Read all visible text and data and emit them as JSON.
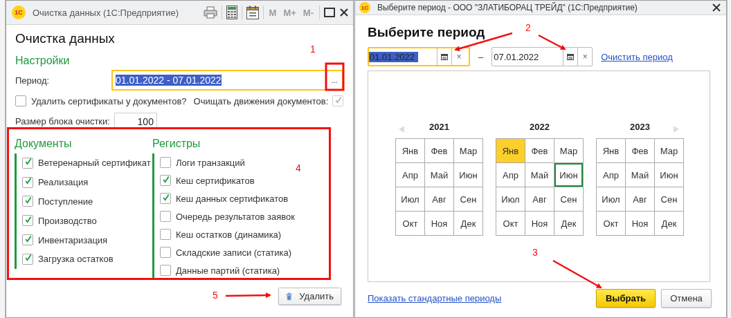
{
  "left_window": {
    "logo": "1С",
    "title": "Очистка данных  (1С:Предприятие)",
    "memory_buttons": [
      {
        "label": "M",
        "disabled": true
      },
      {
        "label": "M+",
        "disabled": true
      },
      {
        "label": "M-",
        "disabled": true
      }
    ],
    "heading": "Очистка данных",
    "settings_heading": "Настройки",
    "period": {
      "label": "Период:",
      "value": "01.01.2022 - 07.01.2022",
      "focused": true,
      "button": "..."
    },
    "options": [
      {
        "kind": "box-first",
        "label": "Удалить сертификаты у документов?",
        "checked": false,
        "disabled": false
      },
      {
        "kind": "label-first",
        "label": "Очищать движения документов:",
        "checked": true,
        "disabled": true
      }
    ],
    "block_size": {
      "label": "Размер блока очистки:",
      "value": "100"
    },
    "documents": {
      "heading": "Документы",
      "items": [
        {
          "label": "Ветеренарный сертификат",
          "checked": true
        },
        {
          "label": "Реализация",
          "checked": true
        },
        {
          "label": "Поступление",
          "checked": true
        },
        {
          "label": "Производство",
          "checked": true
        },
        {
          "label": "Инвентаризация",
          "checked": true
        },
        {
          "label": "Загрузка остатков",
          "checked": true
        }
      ]
    },
    "registers": {
      "heading": "Регистры",
      "items": [
        {
          "label": "Логи транзакций",
          "checked": false
        },
        {
          "label": "Кеш сертификатов",
          "checked": true
        },
        {
          "label": "Кеш данных сертификатов",
          "checked": true
        },
        {
          "label": "Очередь результатов заявок",
          "checked": false
        },
        {
          "label": "Кеш остатков (динамика)",
          "checked": false
        },
        {
          "label": "Складские записи (статика)",
          "checked": false
        },
        {
          "label": "Данные партий (статика)",
          "checked": false
        }
      ]
    },
    "delete_button": "Удалить"
  },
  "right_window": {
    "logo": "1С",
    "title": "Выберите период - ООО \"ЗЛАТИБОРАЦ ТРЕЙД\"  (1С:Предприятие)",
    "heading": "Выберите период",
    "start_date": {
      "value": "01.01.2022",
      "focused": true,
      "clear": "×"
    },
    "dash": "–",
    "end_date": {
      "value": "07.01.2022",
      "focused": false,
      "clear": "×"
    },
    "clear_period_link": "Очистить период",
    "years": [
      {
        "year": "2021",
        "months": [
          {
            "label": "Янв",
            "selected": false,
            "focused": false
          },
          {
            "label": "Фев",
            "selected": false,
            "focused": false
          },
          {
            "label": "Мар",
            "selected": false,
            "focused": false
          },
          {
            "label": "Апр",
            "selected": false,
            "focused": false
          },
          {
            "label": "Май",
            "selected": false,
            "focused": false
          },
          {
            "label": "Июн",
            "selected": false,
            "focused": false
          },
          {
            "label": "Июл",
            "selected": false,
            "focused": false
          },
          {
            "label": "Авг",
            "selected": false,
            "focused": false
          },
          {
            "label": "Сен",
            "selected": false,
            "focused": false
          },
          {
            "label": "Окт",
            "selected": false,
            "focused": false
          },
          {
            "label": "Ноя",
            "selected": false,
            "focused": false
          },
          {
            "label": "Дек",
            "selected": false,
            "focused": false
          }
        ]
      },
      {
        "year": "2022",
        "months": [
          {
            "label": "Янв",
            "selected": true,
            "focused": false
          },
          {
            "label": "Фев",
            "selected": false,
            "focused": false
          },
          {
            "label": "Мар",
            "selected": false,
            "focused": false
          },
          {
            "label": "Апр",
            "selected": false,
            "focused": false
          },
          {
            "label": "Май",
            "selected": false,
            "focused": false
          },
          {
            "label": "Июн",
            "selected": false,
            "focused": true
          },
          {
            "label": "Июл",
            "selected": false,
            "focused": false
          },
          {
            "label": "Авг",
            "selected": false,
            "focused": false
          },
          {
            "label": "Сен",
            "selected": false,
            "focused": false
          },
          {
            "label": "Окт",
            "selected": false,
            "focused": false
          },
          {
            "label": "Ноя",
            "selected": false,
            "focused": false
          },
          {
            "label": "Дек",
            "selected": false,
            "focused": false
          }
        ]
      },
      {
        "year": "2023",
        "months": [
          {
            "label": "Янв",
            "selected": false,
            "focused": false
          },
          {
            "label": "Фев",
            "selected": false,
            "focused": false
          },
          {
            "label": "Мар",
            "selected": false,
            "focused": false
          },
          {
            "label": "Апр",
            "selected": false,
            "focused": false
          },
          {
            "label": "Май",
            "selected": false,
            "focused": false
          },
          {
            "label": "Июн",
            "selected": false,
            "focused": false
          },
          {
            "label": "Июл",
            "selected": false,
            "focused": false
          },
          {
            "label": "Авг",
            "selected": false,
            "focused": false
          },
          {
            "label": "Сен",
            "selected": false,
            "focused": false
          },
          {
            "label": "Окт",
            "selected": false,
            "focused": false
          },
          {
            "label": "Ноя",
            "selected": false,
            "focused": false
          },
          {
            "label": "Дек",
            "selected": false,
            "focused": false
          }
        ]
      }
    ],
    "show_standard_link": "Показать стандартные периоды",
    "ok_button": "Выбрать",
    "cancel_button": "Отмена"
  },
  "annotations": [
    {
      "label": "1"
    },
    {
      "label": "2"
    },
    {
      "label": "3"
    },
    {
      "label": "4"
    },
    {
      "label": "5"
    }
  ]
}
